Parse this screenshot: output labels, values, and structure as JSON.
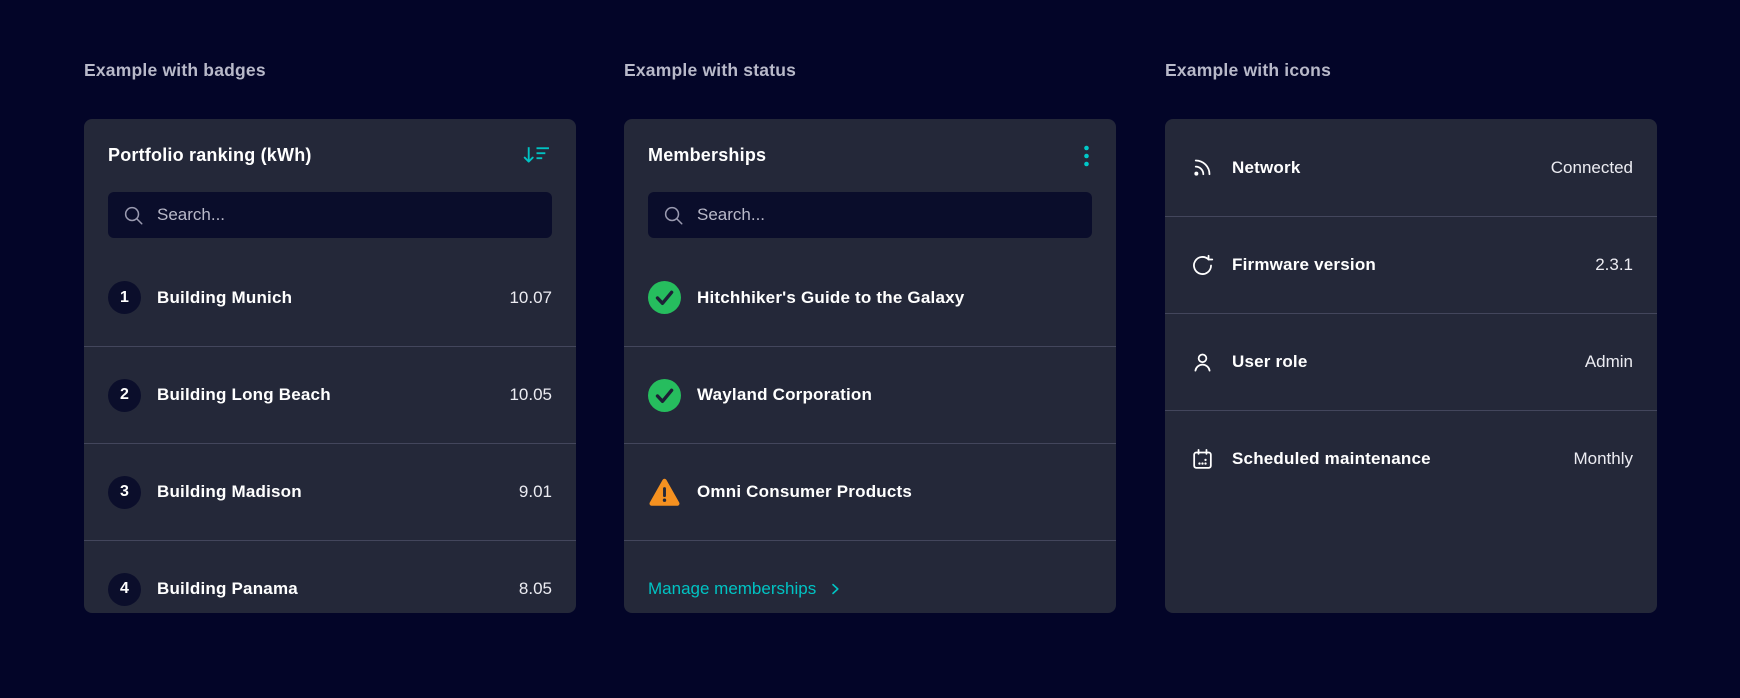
{
  "colors": {
    "background": "#030528",
    "card": "#242839",
    "accent": "#00C3C3",
    "success": "#26BD5E",
    "warning": "#F59120"
  },
  "badges": {
    "heading": "Example with badges",
    "card": {
      "title": "Portfolio ranking (kWh)",
      "header_icon": "sort-descending-icon",
      "search_placeholder": "Search...",
      "search_icon": "search-icon",
      "items": [
        {
          "rank": "1",
          "name": "Building Munich",
          "value": "10.07"
        },
        {
          "rank": "2",
          "name": "Building Long Beach",
          "value": "10.05"
        },
        {
          "rank": "3",
          "name": "Building Madison",
          "value": "9.01"
        },
        {
          "rank": "4",
          "name": "Building Panama",
          "value": "8.05"
        }
      ]
    }
  },
  "status": {
    "heading": "Example with status",
    "card": {
      "title": "Memberships",
      "header_icon": "kebab-menu-icon",
      "search_placeholder": "Search...",
      "search_icon": "search-icon",
      "items": [
        {
          "name": "Hitchhiker's Guide to the Galaxy",
          "status": "success",
          "icon": "success-check-icon"
        },
        {
          "name": "Wayland Corporation",
          "status": "success",
          "icon": "success-check-icon"
        },
        {
          "name": "Omni Consumer Products",
          "status": "warning",
          "icon": "warning-triangle-icon"
        }
      ],
      "footer_link": {
        "label": "Manage memberships",
        "icon": "chevron-right-icon"
      }
    }
  },
  "icons_panel": {
    "heading": "Example with icons",
    "card": {
      "items": [
        {
          "icon": "network-signal-icon",
          "label": "Network",
          "value": "Connected"
        },
        {
          "icon": "refresh-icon",
          "label": "Firmware version",
          "value": "2.3.1"
        },
        {
          "icon": "user-icon",
          "label": "User role",
          "value": "Admin"
        },
        {
          "icon": "calendar-icon",
          "label": "Scheduled maintenance",
          "value": "Monthly"
        }
      ]
    }
  }
}
